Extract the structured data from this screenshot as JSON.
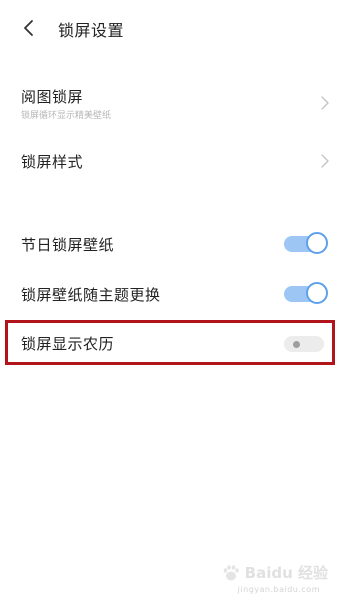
{
  "header": {
    "title": "锁屏设置"
  },
  "rows": [
    {
      "label": "阅图锁屏",
      "sublabel": "锁屏循环显示精美壁纸"
    },
    {
      "label": "锁屏样式"
    },
    {
      "label": "节日锁屏壁纸",
      "toggle": "on"
    },
    {
      "label": "锁屏壁纸随主题更换",
      "toggle": "on"
    },
    {
      "label": "锁屏显示农历",
      "toggle": "off"
    }
  ],
  "watermark": {
    "text": "Baidu 经验",
    "sub": "jingyan.baidu.com"
  },
  "colors": {
    "toggle_on_track": "#9dc6f4",
    "toggle_on_knob_border": "#5ea0ec",
    "toggle_off_track": "#ececec",
    "highlight_border": "#b1151b"
  }
}
